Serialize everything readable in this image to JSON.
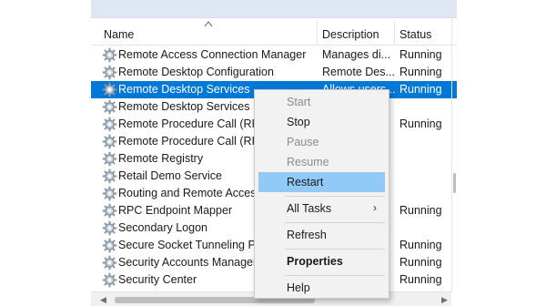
{
  "columns": {
    "name": "Name",
    "description": "Description",
    "status": "Status"
  },
  "rows": [
    {
      "name": "Remote Access Connection Manager",
      "description": "Manages di...",
      "status": "Running",
      "selected": false
    },
    {
      "name": "Remote Desktop Configuration",
      "description": "Remote Des...",
      "status": "Running",
      "selected": false
    },
    {
      "name": "Remote Desktop Services",
      "description": "Allows users...",
      "status": "Running",
      "selected": true
    },
    {
      "name": "Remote Desktop Services UserMode Port Redirector",
      "description": "",
      "status": "",
      "selected": false
    },
    {
      "name": "Remote Procedure Call (RPC)",
      "description": "",
      "status": "Running",
      "selected": false
    },
    {
      "name": "Remote Procedure Call (RPC) Locator",
      "description": "",
      "status": "",
      "selected": false
    },
    {
      "name": "Remote Registry",
      "description": "",
      "status": "",
      "selected": false
    },
    {
      "name": "Retail Demo Service",
      "description": "",
      "status": "",
      "selected": false
    },
    {
      "name": "Routing and Remote Access",
      "description": "",
      "status": "",
      "selected": false
    },
    {
      "name": "RPC Endpoint Mapper",
      "description": "",
      "status": "Running",
      "selected": false
    },
    {
      "name": "Secondary Logon",
      "description": "",
      "status": "",
      "selected": false
    },
    {
      "name": "Secure Socket Tunneling Protocol Service",
      "description": "",
      "status": "Running",
      "selected": false
    },
    {
      "name": "Security Accounts Manager",
      "description": "",
      "status": "Running",
      "selected": false
    },
    {
      "name": "Security Center",
      "description": "",
      "status": "Running",
      "selected": false
    }
  ],
  "context_menu": {
    "start": "Start",
    "stop": "Stop",
    "pause": "Pause",
    "resume": "Resume",
    "restart": "Restart",
    "all_tasks": "All Tasks",
    "all_tasks_arrow": "›",
    "refresh": "Refresh",
    "properties": "Properties",
    "help": "Help"
  },
  "scrollbar": {
    "left_arrow": "◀",
    "right_arrow": "▶"
  },
  "colors": {
    "selection": "#0078d7",
    "menu_hover": "#91c9f7",
    "menu_background": "#f2f2f2"
  },
  "icons": {
    "row_icon": "gear-icon",
    "sort": "sort-ascending-icon"
  }
}
